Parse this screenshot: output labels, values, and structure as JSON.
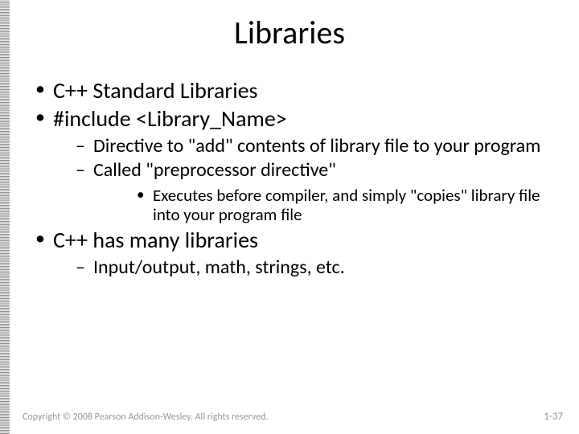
{
  "title": "Libraries",
  "bullets": {
    "l1a": "C++ Standard Libraries",
    "l1b": "#include <Library_Name>",
    "l2a": "Directive to \"add\" contents of library file to your program",
    "l2b": "Called \"preprocessor directive\"",
    "l3a": "Executes before compiler, and simply \"copies\" library file into your program file",
    "l1c": "C++ has many libraries",
    "l2c": "Input/output, math, strings, etc."
  },
  "footer": {
    "copyright": "Copyright © 2008 Pearson Addison-Wesley. All rights reserved.",
    "page": "1-37"
  }
}
